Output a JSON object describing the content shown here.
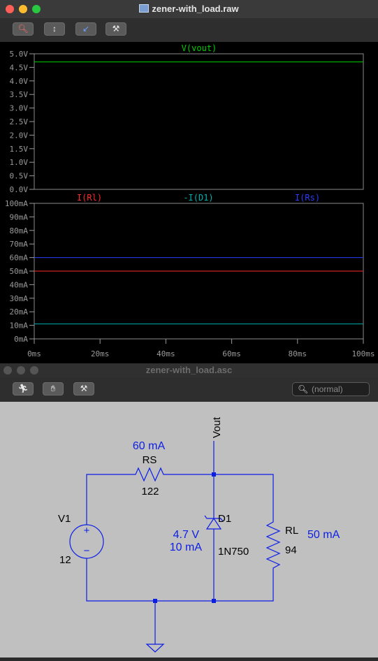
{
  "plot_window": {
    "title": "zener-with_load.raw",
    "toolbar": [
      "zoom-icon",
      "autorange-icon",
      "measure-icon",
      "hammer-icon"
    ]
  },
  "schematic_window": {
    "title": "zener-with_load.asc",
    "toolbar": [
      "run-icon",
      "hand-icon",
      "hammer-icon"
    ],
    "search_placeholder": "(normal)"
  },
  "colors": {
    "vout": "#00d000",
    "irl": "#ff2a2a",
    "id1": "#00b0b0",
    "irs": "#2a3cff",
    "wire": "#0c1ee6",
    "schem_bg": "#c0c0c0"
  },
  "chart_data": [
    {
      "type": "line",
      "title": "",
      "series": [
        {
          "name": "V(vout)",
          "x": [
            0,
            100
          ],
          "y": [
            4.7,
            4.7
          ]
        }
      ],
      "yticks": [
        "5.0V",
        "4.5V",
        "4.0V",
        "3.5V",
        "3.0V",
        "2.5V",
        "2.0V",
        "1.5V",
        "1.0V",
        "0.5V",
        "0.0V"
      ],
      "ylim": [
        0,
        5.0
      ],
      "xlim": [
        0,
        100
      ],
      "grid": false
    },
    {
      "type": "line",
      "series": [
        {
          "name": "I(Rl)",
          "x": [
            0,
            100
          ],
          "y": [
            50,
            50
          ]
        },
        {
          "name": "-I(D1)",
          "x": [
            0,
            100
          ],
          "y": [
            11,
            11
          ]
        },
        {
          "name": "I(Rs)",
          "x": [
            0,
            100
          ],
          "y": [
            60,
            60
          ]
        }
      ],
      "yticks": [
        "100mA",
        "90mA",
        "80mA",
        "70mA",
        "60mA",
        "50mA",
        "40mA",
        "30mA",
        "20mA",
        "10mA",
        "0mA"
      ],
      "ylim": [
        0,
        100
      ],
      "xticks": [
        "0ms",
        "20ms",
        "40ms",
        "60ms",
        "80ms",
        "100ms"
      ],
      "xlim": [
        0,
        100
      ],
      "grid": false
    }
  ],
  "schematic": {
    "net_label": "Vout",
    "rs": {
      "name": "RS",
      "value": "122",
      "current": "60 mA"
    },
    "v1": {
      "name": "V1",
      "value": "12"
    },
    "d1": {
      "name": "D1",
      "model": "1N750",
      "voltage": "4.7 V",
      "current": "10 mA"
    },
    "rl": {
      "name": "RL",
      "value": "94",
      "current": "50 mA"
    }
  }
}
